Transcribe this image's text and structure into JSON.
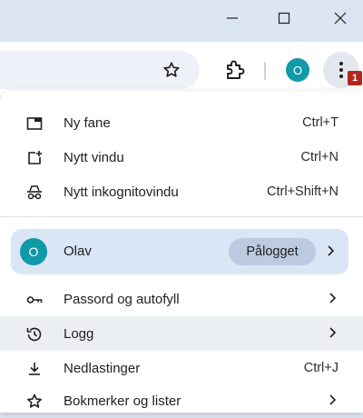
{
  "window": {
    "minimize": "minimize-window",
    "maximize": "maximize-window",
    "close": "close-window"
  },
  "toolbar": {
    "profile_initial": "O",
    "update_badge": "1"
  },
  "menu": {
    "items_top": [
      {
        "label": "Ny fane",
        "shortcut": "Ctrl+T",
        "icon": "new-tab-icon"
      },
      {
        "label": "Nytt vindu",
        "shortcut": "Ctrl+N",
        "icon": "new-window-icon"
      },
      {
        "label": "Nytt inkognitovindu",
        "shortcut": "Ctrl+Shift+N",
        "icon": "incognito-icon"
      }
    ],
    "profile": {
      "initial": "O",
      "name": "Olav",
      "status": "Pålogget"
    },
    "items_bottom": [
      {
        "label": "Passord og autofyll",
        "icon": "key-icon",
        "has_submenu": true
      },
      {
        "label": "Logg",
        "icon": "history-icon",
        "has_submenu": true,
        "highlighted": true
      },
      {
        "label": "Nedlastinger",
        "shortcut": "Ctrl+J",
        "icon": "download-icon"
      },
      {
        "label": "Bokmerker og lister",
        "icon": "star-icon",
        "has_submenu": true
      }
    ]
  }
}
